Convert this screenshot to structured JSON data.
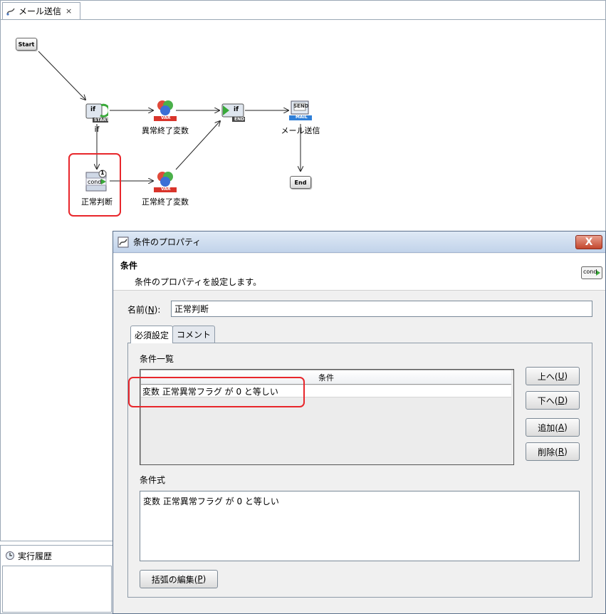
{
  "editor": {
    "tab_title": "メール送信",
    "tab_close": "×"
  },
  "flow": {
    "start_label": "Start",
    "end_label": "End",
    "if_start": {
      "top": "if",
      "badge": "START",
      "label": "if"
    },
    "var_abnormal": {
      "badge": "VAR",
      "label": "異常終了変数"
    },
    "var_normal": {
      "badge": "VAR",
      "label": "正常終了変数"
    },
    "if_end": {
      "top": "if",
      "badge": "END"
    },
    "mail": {
      "top": "SEND",
      "badge": "MAIL",
      "label": "メール送信"
    },
    "cond": {
      "top": "cond",
      "count": "1",
      "label": "正常判断"
    }
  },
  "history": {
    "title": "実行履歴"
  },
  "dialog": {
    "title": "条件のプロパティ",
    "close": "X",
    "header_title": "条件",
    "header_desc": "条件のプロパティを設定します。",
    "header_icon": "cond",
    "name_label": "名前(",
    "name_mnemonic": "N",
    "name_label_end": "):",
    "name_value": "正常判断",
    "tabs": [
      {
        "label": "必須設定",
        "active": true
      },
      {
        "label": "コメント",
        "active": false
      }
    ],
    "list_label": "条件一覧",
    "table_header": "条件",
    "rows": [
      "変数 正常異常フラグ が 0 と等しい"
    ],
    "buttons": {
      "up": {
        "label": "上へ(",
        "mn": "U",
        "end": ")"
      },
      "down": {
        "label": "下へ(",
        "mn": "D",
        "end": ")"
      },
      "add": {
        "label": "追加(",
        "mn": "A",
        "end": ")"
      },
      "delete": {
        "label": "削除(",
        "mn": "R",
        "end": ")"
      }
    },
    "expr_label": "条件式",
    "expr_value": "変数 正常異常フラグ が 0 と等しい",
    "edit_paren": {
      "label": "括弧の編集(",
      "mn": "P",
      "end": ")"
    }
  },
  "colors": {
    "highlight": "#e8262b",
    "title_bar": "#c2d3ea",
    "close": "#c3472d"
  }
}
